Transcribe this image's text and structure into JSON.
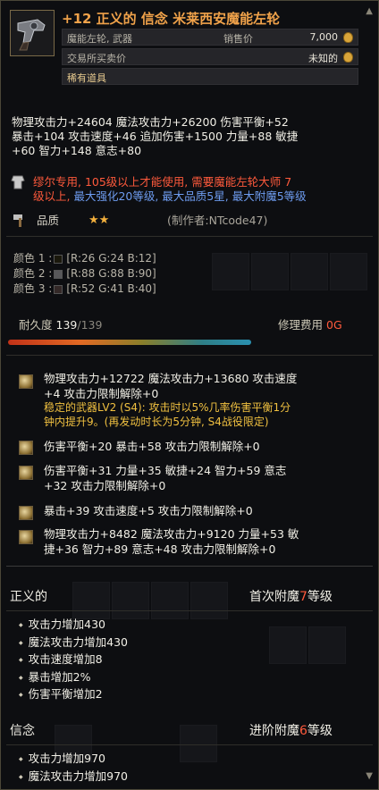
{
  "header": {
    "title": "+12 正义的 信念 米莱西安魔能左轮",
    "category": "魔能左轮, 武器",
    "sell_label": "销售价",
    "sell_value": "7,000",
    "trade_label": "交易所买卖价",
    "trade_value": "未知的",
    "rarity": "稀有道具"
  },
  "stats": {
    "line1": "物理攻击力+24604  魔法攻击力+26200  伤害平衡+52",
    "line2": "暴击+104  攻击速度+46  追加伤害+1500  力量+88  敏捷",
    "line3": "+60  智力+148  意志+80"
  },
  "requirements": {
    "line1_a": "缪尔专用, ",
    "line1_b": "105级以上才能使用, 需要魔能左轮大师 7",
    "line2_a": "级以上, ",
    "line2_b": "最大强化20等级, 最大品质5星, 最大附魔5等级"
  },
  "quality": {
    "label": "品质",
    "stars": "★★",
    "maker": "(制作者:NTcode47)"
  },
  "colors": [
    {
      "label": "颜色 1 :",
      "value": "[R:26 G:24 B:12]",
      "hex": "#1a180c"
    },
    {
      "label": "颜色 2 :",
      "value": "[R:88 G:88 B:90]",
      "hex": "#58585a"
    },
    {
      "label": "颜色 3 :",
      "value": "[R:52 G:41 B:40]",
      "hex": "#342928"
    }
  ],
  "durability": {
    "label": "耐久度",
    "current": "139",
    "max": "/139",
    "repair_label": "修理费用",
    "repair_value": "0G",
    "level": 1.0
  },
  "buffs": [
    {
      "text1": "物理攻击力+12722  魔法攻击力+13680  攻击速度",
      "text2": "+4  攻击力限制解除+0",
      "set1": "稳定的武器LV2 (S4): 攻击时以5%几率伤害平衡1分",
      "set2": "钟内提升9。(再发动时长为5分钟, S4战役限定)"
    },
    {
      "text1": "伤害平衡+20  暴击+58  攻击力限制解除+0"
    },
    {
      "text1": "伤害平衡+31  力量+35  敏捷+24  智力+59  意志",
      "text2": "+32  攻击力限制解除+0"
    },
    {
      "text1": "暴击+39  攻击速度+5  攻击力限制解除+0"
    },
    {
      "text1": "物理攻击力+8482  魔法攻击力+9120  力量+53  敏",
      "text2": "捷+36  智力+89  意志+48  攻击力限制解除+0"
    }
  ],
  "enchant1": {
    "name": "正义的",
    "rank_a": "首次附魔",
    "rank_num": "7",
    "rank_b": "等级",
    "effects": [
      "攻击力增加430",
      "魔法攻击力增加430",
      "攻击速度增加8",
      "暴击增加2%",
      "伤害平衡增加2"
    ]
  },
  "enchant2": {
    "name": "信念",
    "rank_a": "进阶附魔",
    "rank_num": "6",
    "rank_b": "等级",
    "effects": [
      "攻击力增加970",
      "魔法攻击力增加970"
    ]
  }
}
